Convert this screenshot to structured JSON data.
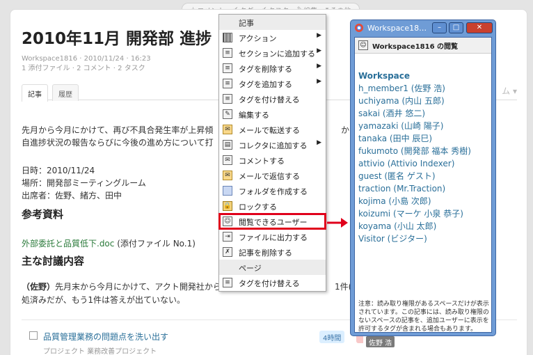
{
  "toolbar": {
    "items": [
      {
        "label": "コメント"
      },
      {
        "label": "タグ"
      },
      {
        "label": "タスク"
      },
      {
        "label": "編集"
      },
      {
        "label": "その他"
      }
    ]
  },
  "article": {
    "title": "2010年11月 開発部 進捗",
    "meta_line1": "Workspace1816 · 2010/11/24 · 16:23",
    "meta_line2": "1 添付ファイル · 2 コメント · 2 タスク",
    "tabs": [
      {
        "label": "記事"
      },
      {
        "label": "履歴"
      }
    ],
    "tab_right": "ム ▾",
    "para1_line1": "先月から今月にかけて、再び不具合発生率が上昇傾",
    "para1_line1_tail": "からの",
    "para1_line2": "自進捗状況の報告ならびに今後の進め方について打",
    "date_line": "日時：2010/11/24",
    "place_line": "場所：開発部ミーティングルーム",
    "attendees_line": "出席者：佐野、緒方、田中",
    "refs_heading": "参考資料",
    "attach_link": "外部委託と品質低下.doc",
    "attach_note": "(添付ファイル No.1)",
    "main_heading": "主な討議内容",
    "disc_name": "（佐野）",
    "disc_line1": "先月末から今月にかけて、アクト開発社から",
    "disc_line1_tail": "1件(",
    "disc_line2": "処済みだが、もう1件は答えが出ていない。",
    "task_title": "品質管理業務の問題点を洗い出す",
    "task_sub": "プロジェクト 業務改善プロジェクト",
    "task_badge": "4時間"
  },
  "menu": {
    "header1": "記事",
    "items1": [
      {
        "label": "アクション",
        "icon": "barcode-icon",
        "sub": true
      },
      {
        "label": "セクションに追加する",
        "icon": "document-icon",
        "sub": true
      },
      {
        "label": "タグを削除する",
        "icon": "document-icon",
        "sub": true
      },
      {
        "label": "タグを追加する",
        "icon": "document-icon",
        "sub": true
      },
      {
        "label": "タグを付け替える",
        "icon": "document-icon",
        "sub": false
      },
      {
        "label": "編集する",
        "icon": "edit-icon",
        "sub": false
      },
      {
        "label": "メールで転送する",
        "icon": "mail-icon",
        "sub": false
      },
      {
        "label": "コレクタに追加する",
        "icon": "collector-icon",
        "sub": true
      },
      {
        "label": "コメントする",
        "icon": "comment-icon",
        "sub": false
      },
      {
        "label": "メールで返信する",
        "icon": "mail-icon",
        "sub": false
      },
      {
        "label": "フォルダを作成する",
        "icon": "folder-icon",
        "sub": false
      },
      {
        "label": "ロックする",
        "icon": "lock-icon",
        "sub": false
      },
      {
        "label": "閲覧できるユーザー",
        "icon": "users-icon",
        "sub": false
      },
      {
        "label": "ファイルに出力する",
        "icon": "export-icon",
        "sub": false
      },
      {
        "label": "記事を削除する",
        "icon": "delete-icon",
        "sub": false
      }
    ],
    "header2": "ページ",
    "items2": [
      {
        "label": "タグを付け替える",
        "icon": "document-icon",
        "sub": false
      }
    ]
  },
  "popup": {
    "window_title": "Workspace18…",
    "heading": "Workspace1816 の閲覧",
    "users_header": "Workspace",
    "users": [
      "h_member1 (佐野 浩)",
      "uchiyama (内山 五郎)",
      "sakai (酒井 悠二)",
      "yamazaki (山崎 陽子)",
      "tanaka (田中 辰巳)",
      "fukumoto (開発部 福本 秀樹)",
      "attivio (Attivio Indexer)",
      "guest (匿名 ゲスト)",
      "traction (Mr.Traction)",
      "kojima (小島 次郎)",
      "koizumi (マーケ 小泉 恭子)",
      "koyama (小山 太郎)",
      "Visitor (ビジター)"
    ],
    "note": "注意：読み取り権限があるスペースだけが表示されています。この記事には、読み取り権限のないスペースの記事を、追加ユーザーに表示を許可するタグが含まれる場合もあります。",
    "tooltip": "佐野 浩"
  },
  "colors": {
    "link": "#2a6f99",
    "highlight": "#e0001b",
    "window_frame": "#6f9cd6"
  }
}
